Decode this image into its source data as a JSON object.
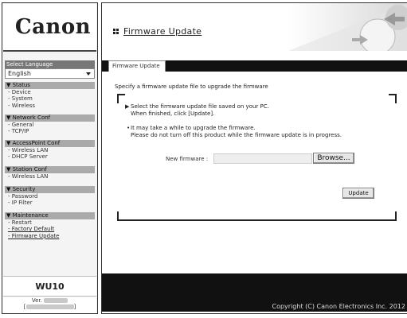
{
  "sidebar": {
    "logo": "Canon",
    "language_label": "Select Language",
    "language_value": "English",
    "groups": [
      {
        "head": "▼ Status",
        "items": [
          "- Device",
          "- System",
          "- Wireless"
        ]
      },
      {
        "head": "▼ Network Conf",
        "items": [
          "- General",
          "- TCP/IP"
        ]
      },
      {
        "head": "▼ AccessPoint Conf",
        "items": [
          "- Wireless LAN",
          "- DHCP Server"
        ]
      },
      {
        "head": "▼ Station Conf",
        "items": [
          "- Wireless LAN"
        ]
      },
      {
        "head": "▼ Security",
        "items": [
          "- Password",
          "- IP Filter"
        ]
      },
      {
        "head": "▼ Maintenance",
        "items": [
          "- Restart",
          "- Factory Default",
          "- Firmware Update"
        ]
      }
    ],
    "model": "WU10",
    "version_label": "Ver."
  },
  "header": {
    "title": "Firmware Update"
  },
  "tabs": [
    {
      "label": "Firmware Update",
      "active": true
    }
  ],
  "content": {
    "intro": "Specify a firmware update file to upgrade the firmware",
    "step1_line1": "Select the firmware update file saved on your PC.",
    "step1_line2": "When finished, click [Update].",
    "note_line1": "It may take a while to upgrade the firmware.",
    "note_line2": "Please do not turn off this product while the firmware update is in progress.",
    "new_firmware_label": "New firmware :",
    "new_firmware_value": "",
    "browse_label": "Browse...",
    "update_label": "Update"
  },
  "footer": {
    "copyright": "Copyright (C) Canon Electronics Inc. 2012"
  },
  "colors": {
    "accent_dark": "#111111",
    "sidebar_header": "#aaaaaa",
    "page_bg": "#ffffff"
  },
  "icons": {
    "title_icon": "grid-squares-icon",
    "step_icon": "triangle-right-icon",
    "dropdown_icon": "chevron-down-icon"
  }
}
